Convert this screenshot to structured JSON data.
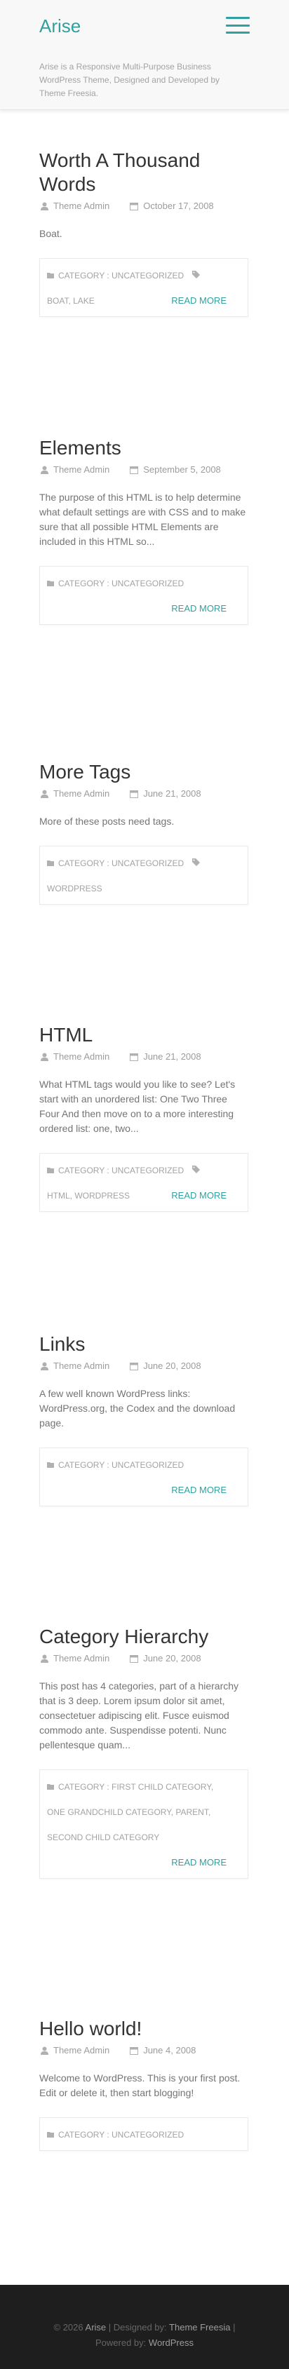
{
  "site": {
    "title": "Arise",
    "tagline": "Arise is a Responsive Multi-Purpose Business WordPress Theme, Designed and Developed by Theme Freesia."
  },
  "posts": [
    {
      "title": "Worth A Thousand Words",
      "author": "Theme Admin",
      "date": "October 17, 2008",
      "excerpt": "Boat.",
      "category": "CATEGORY : UNCATEGORIZED",
      "tags": "BOAT, LAKE",
      "read_more": "READ MORE"
    },
    {
      "title": "Elements",
      "author": "Theme Admin",
      "date": "September 5, 2008",
      "excerpt": "The purpose of this HTML is to help determine what default settings are with CSS and to make sure that all possible HTML Elements are included in this HTML so...",
      "category": "CATEGORY : UNCATEGORIZED",
      "read_more": "READ MORE"
    },
    {
      "title": "More Tags",
      "author": "Theme Admin",
      "date": "June 21, 2008",
      "excerpt": "More of these posts need tags.",
      "category": "CATEGORY : UNCATEGORIZED",
      "tags": "WORDPRESS"
    },
    {
      "title": "HTML",
      "author": "Theme Admin",
      "date": "June 21, 2008",
      "excerpt": "What HTML tags would you like to see? Let's start with an unordered list: One Two Three Four And then move on to a more interesting ordered list: one, two...",
      "category": "CATEGORY : UNCATEGORIZED",
      "tags": "HTML, WORDPRESS",
      "read_more": "READ MORE"
    },
    {
      "title": "Links",
      "author": "Theme Admin",
      "date": "June 20, 2008",
      "excerpt": "A few well known WordPress links: WordPress.org, the Codex and the download page.",
      "category": "CATEGORY : UNCATEGORIZED",
      "read_more": "READ MORE"
    },
    {
      "title": "Category Hierarchy",
      "author": "Theme Admin",
      "date": "June 20, 2008",
      "excerpt": "This post has 4 categories, part of a hierarchy that is 3 deep. Lorem ipsum dolor sit amet, consectetuer adipiscing elit. Fusce euismod commodo ante. Suspendisse potenti. Nunc pellentesque quam...",
      "category": "CATEGORY : FIRST CHILD CATEGORY,",
      "category2": "ONE GRANDCHILD CATEGORY, PARENT,",
      "category3": "SECOND CHILD CATEGORY",
      "read_more": "READ MORE"
    },
    {
      "title": "Hello world!",
      "author": "Theme Admin",
      "date": "June 4, 2008",
      "excerpt": "Welcome to WordPress. This is your first post. Edit or delete it, then start blogging!",
      "category": "CATEGORY : UNCATEGORIZED"
    }
  ],
  "footer": {
    "copyright_prefix": "© 2026",
    "site_link": "Arise",
    "designed_by_label": "| Designed by:",
    "designer_link": "Theme Freesia",
    "pipe": "|",
    "powered_by_label": "Powered by:",
    "powered_link": "WordPress"
  },
  "colors": {
    "accent": "#30a1a0",
    "title": "#333333",
    "meta": "#9c9c9c",
    "footer_bg": "#1e1e1e"
  },
  "icons": {
    "menu": "hamburger-icon",
    "author": "user-icon",
    "date": "calendar-icon",
    "category": "folder-icon",
    "tags": "tag-icon"
  }
}
